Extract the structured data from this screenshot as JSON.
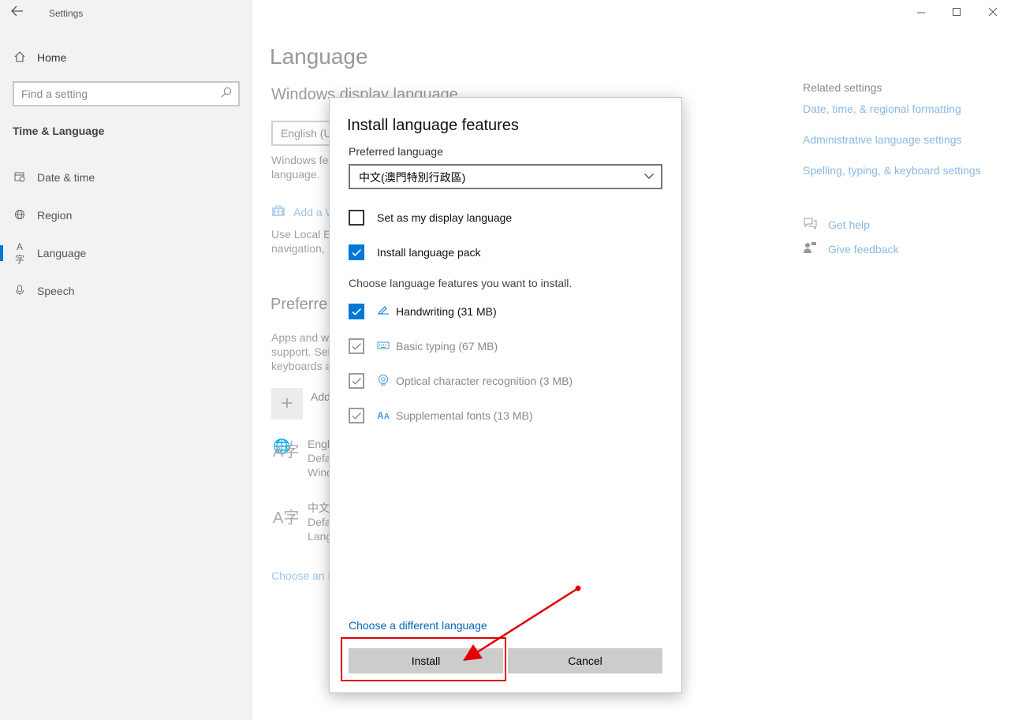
{
  "app": {
    "title": "Settings",
    "back_icon": "back-arrow-icon"
  },
  "window": {
    "minimize": "–",
    "maximize": "☐",
    "close": "✕"
  },
  "sidebar": {
    "home": {
      "icon": "home-icon",
      "label": "Home"
    },
    "search": {
      "placeholder": "Find a setting",
      "icon": "search-icon"
    },
    "section": "Time & Language",
    "items": [
      {
        "icon": "calendar-clock-icon",
        "label": "Date & time"
      },
      {
        "icon": "globe-icon",
        "label": "Region"
      },
      {
        "icon": "language-icon",
        "label": "Language",
        "active": true
      },
      {
        "icon": "microphone-icon",
        "label": "Speech"
      }
    ]
  },
  "main": {
    "title": "Language",
    "display_language_heading": "Windows display language",
    "display_language_value": "English (U",
    "display_text": [
      "Windows fe",
      "language."
    ],
    "add_link": "Add a W",
    "local_text": [
      "Use Local Ex",
      "navigation,"
    ],
    "preferred_heading": "Preferre",
    "preferred_text": [
      "Apps and w",
      "support. Sel",
      "keyboards a"
    ],
    "add_label": "Add",
    "languages": [
      {
        "name": "Engl",
        "line1": "Defa",
        "line2": "Wind"
      },
      {
        "name": "中文",
        "line1": "Defa",
        "line2": "Lang"
      }
    ],
    "choose_link": "Choose an i"
  },
  "related": {
    "title": "Related settings",
    "links": [
      "Date, time, & regional formatting",
      "Administrative language settings",
      "Spelling, typing, & keyboard settings"
    ],
    "help": {
      "icon": "chat-help-icon",
      "label": "Get help"
    },
    "feedback": {
      "icon": "feedback-person-icon",
      "label": "Give feedback"
    }
  },
  "dialog": {
    "title": "Install language features",
    "preferred_label": "Preferred language",
    "preferred_value": "中文(澳門特別行政區)",
    "options": [
      {
        "label": "Set as my display language",
        "checked": false
      },
      {
        "label": "Install language pack",
        "checked": true
      }
    ],
    "features_label": "Choose language features you want to install.",
    "features": [
      {
        "icon": "pen-icon",
        "label": "Handwriting (31 MB)",
        "checked": true,
        "disabled": false
      },
      {
        "icon": "keyboard-icon",
        "label": "Basic typing (67 MB)",
        "checked": true,
        "disabled": true
      },
      {
        "icon": "ocr-eye-icon",
        "label": "Optical character recognition (3 MB)",
        "checked": true,
        "disabled": true
      },
      {
        "icon": "font-icon",
        "label": "Supplemental fonts (13 MB)",
        "checked": true,
        "disabled": true
      }
    ],
    "different_language_link": "Choose a different language",
    "install_label": "Install",
    "cancel_label": "Cancel"
  },
  "annotation": {
    "color": "#e30000"
  },
  "colors": {
    "accent": "#0078d7",
    "link": "#0067b8",
    "button": "#cccccc"
  }
}
